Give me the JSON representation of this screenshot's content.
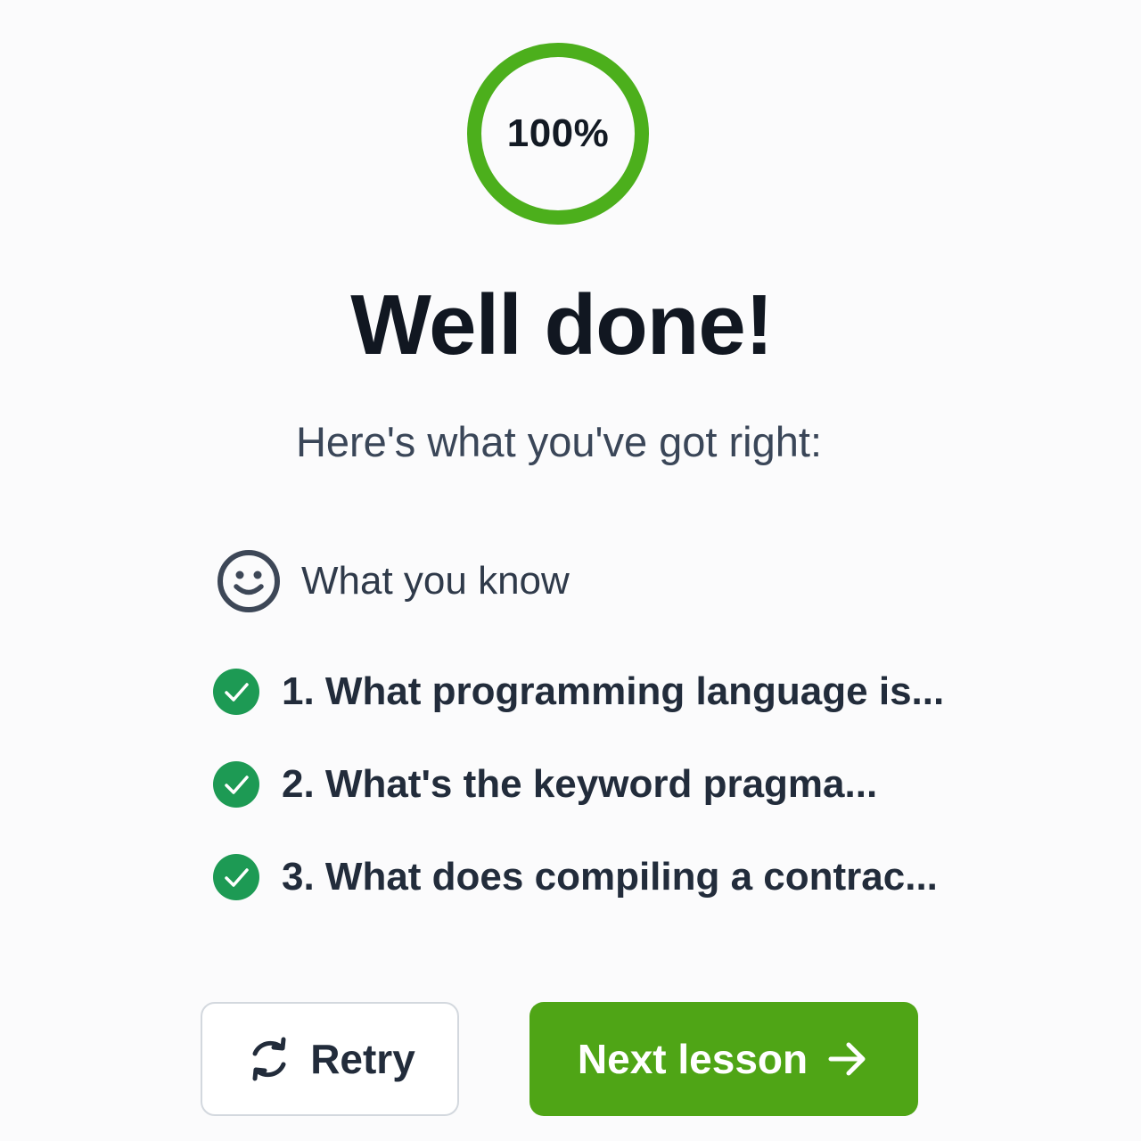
{
  "score": {
    "label": "100%",
    "progress": 1.0,
    "ring_color": "#4caf1c"
  },
  "title": "Well done!",
  "subtitle": "Here's what you've got right:",
  "section": {
    "icon": "smile-icon",
    "label": "What you know"
  },
  "answers": [
    {
      "text": "1. What programming language is...",
      "icon": "check-circle-icon",
      "correct": true
    },
    {
      "text": "2. What's the keyword pragma...",
      "icon": "check-circle-icon",
      "correct": true
    },
    {
      "text": "3. What does compiling a contrac...",
      "icon": "check-circle-icon",
      "correct": true
    }
  ],
  "buttons": {
    "retry_label": "Retry",
    "retry_icon": "refresh-icon",
    "next_label": "Next lesson",
    "next_icon": "arrow-right-icon"
  },
  "colors": {
    "accent": "#4fa516",
    "check": "#1d9a54",
    "text": "#111721"
  }
}
